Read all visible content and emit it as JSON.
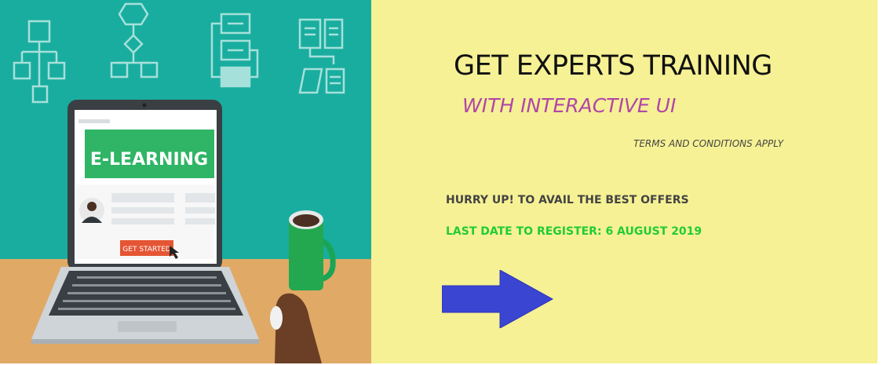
{
  "illustration": {
    "screen_heading": "E-LEARNING",
    "cta_label": "GET STARTED"
  },
  "promo": {
    "title": "GET EXPERTS TRAINING",
    "subtitle": "WITH INTERACTIVE UI",
    "terms": "TERMS AND CONDITIONS APPLY",
    "hurry": "HURRY UP! TO AVAIL THE BEST OFFERS",
    "last_date": "LAST DATE TO REGISTER: 6 AUGUST 2019"
  },
  "colors": {
    "banner_bg": "#f6f194",
    "teal_bg": "#19ad9f",
    "desk": "#e0a966",
    "subtitle": "#b046a8",
    "last_date": "#22cc33",
    "arrow": "#3a45d2"
  },
  "icons": [
    "flowchart-icon",
    "workflow-icon",
    "document-flow-icon",
    "list-flow-icon",
    "right-arrow-icon"
  ]
}
